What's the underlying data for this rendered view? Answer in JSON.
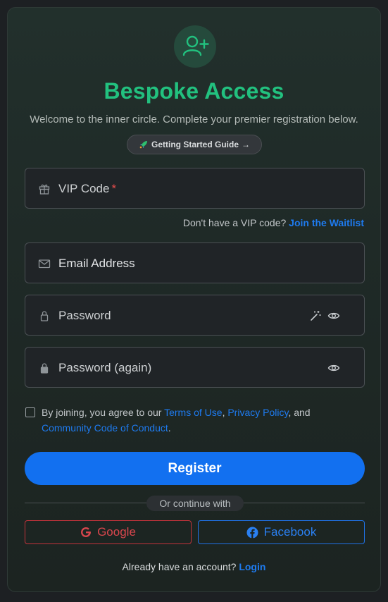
{
  "header": {
    "icon": "user-plus-icon",
    "title": "Bespoke Access",
    "subtitle": "Welcome to the inner circle. Complete your premier registration below.",
    "guide_label": "Getting Started Guide",
    "guide_arrow": "→",
    "guide_icon": "rocket-icon"
  },
  "fields": {
    "vip_code": {
      "label": "VIP Code",
      "required_mark": "*",
      "icon": "gift-icon"
    },
    "email": {
      "label": "Email Address",
      "icon": "mail-icon"
    },
    "password": {
      "label": "Password",
      "icon": "lock-icon",
      "generate_icon": "magic-wand-icon",
      "reveal_icon": "eye-icon"
    },
    "password_again": {
      "label": "Password (again)",
      "icon": "lock-icon",
      "reveal_icon": "eye-icon"
    }
  },
  "vip_hint": {
    "text": "Don't have a VIP code?",
    "link": "Join the Waitlist"
  },
  "terms": {
    "prefix": "By joining, you agree to our",
    "terms_link": "Terms of Use",
    "comma": ",",
    "privacy_link": "Privacy Policy",
    "and": ", and",
    "conduct_link": "Community Code of Conduct",
    "period": "."
  },
  "register_label": "Register",
  "divider_text": "Or continue with",
  "social": {
    "google": "Google",
    "facebook": "Facebook"
  },
  "footer": {
    "text": "Already have an account?",
    "link": "Login"
  },
  "colors": {
    "accent_green": "#22c17f",
    "primary_blue": "#1270f0",
    "link_blue": "#1e7bf0",
    "google_red": "#d8464d",
    "required_red": "#e14b4b"
  }
}
